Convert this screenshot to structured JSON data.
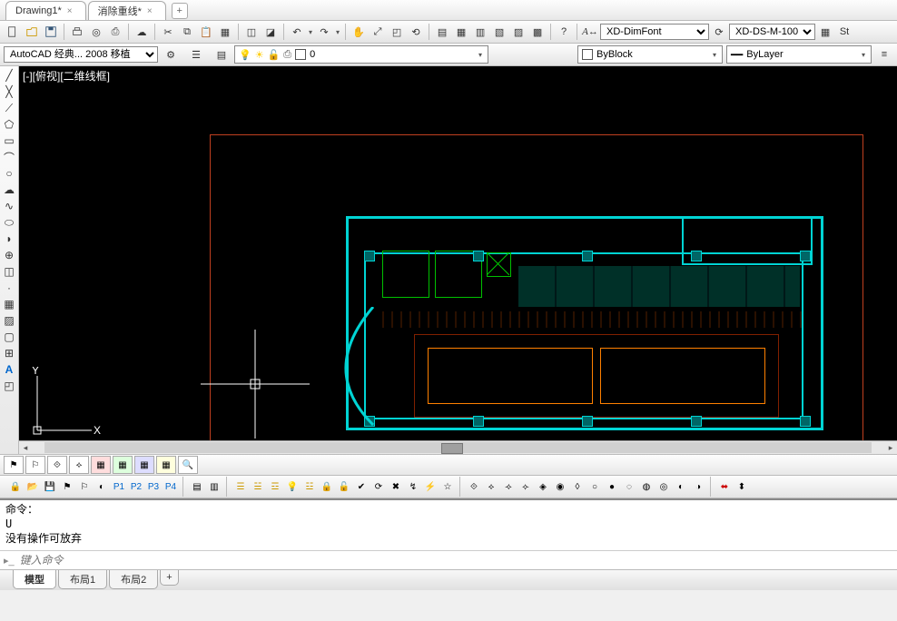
{
  "tabs": {
    "doc1": "Drawing1*",
    "doc2": "消除重线*",
    "add": "+"
  },
  "workspace": {
    "name": "AutoCAD 经典... 2008 移植"
  },
  "layer": {
    "current": "0"
  },
  "props": {
    "color": "ByBlock",
    "linetype": "ByLayer"
  },
  "styles": {
    "dim": "XD-DimFont",
    "dimscale": "XD-DS-M-100",
    "text_btn": "St"
  },
  "viewport": {
    "label": "[-][俯视][二维线框]"
  },
  "ucs": {
    "x": "X",
    "y": "Y"
  },
  "status_icons": {
    "p1": "P1",
    "p2": "P2",
    "p3": "P3",
    "p4": "P4"
  },
  "command": {
    "line1": "命令：",
    "line2": "U",
    "line3": "没有操作可放弃",
    "placeholder": "键入命令"
  },
  "bottom_tabs": {
    "model": "模型",
    "layout1": "布局1",
    "layout2": "布局2",
    "add": "+"
  }
}
